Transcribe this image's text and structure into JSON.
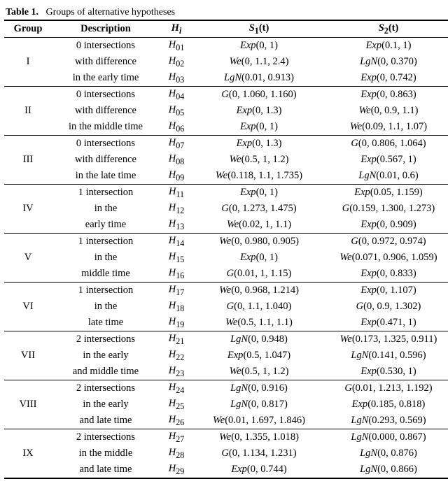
{
  "caption": {
    "label": "Table 1.",
    "text": "Groups of alternative hypotheses"
  },
  "headers": {
    "group": "Group",
    "description": "Description",
    "hi": "H",
    "hi_sub": "i",
    "s1": "S",
    "s1_sub": "1",
    "s1_arg": "(t)",
    "s2": "S",
    "s2_sub": "2",
    "s2_arg": "(t)"
  },
  "groups": [
    {
      "label": "I",
      "desc": [
        "0 intersections",
        "with difference",
        "in the early time"
      ],
      "rows": [
        {
          "h_pre": "H",
          "h_sub": "01",
          "s1": "Exp(0, 1)",
          "s2": "Exp(0.1, 1)"
        },
        {
          "h_pre": "H",
          "h_sub": "02",
          "s1": "We(0, 1.1, 2.4)",
          "s2": "LgN(0, 0.370)"
        },
        {
          "h_pre": "H",
          "h_sub": "03",
          "s1": "LgN(0.01, 0.913)",
          "s2": "Exp(0, 0.742)"
        }
      ]
    },
    {
      "label": "II",
      "desc": [
        "0 intersections",
        "with difference",
        "in the middle time"
      ],
      "rows": [
        {
          "h_pre": "H",
          "h_sub": "04",
          "s1": "G(0, 1.060, 1.160)",
          "s2": "Exp(0, 0.863)"
        },
        {
          "h_pre": "H",
          "h_sub": "05",
          "s1": "Exp(0, 1.3)",
          "s2": "We(0, 0.9, 1.1)"
        },
        {
          "h_pre": "H",
          "h_sub": "06",
          "s1": "Exp(0, 1)",
          "s2": "We(0.09, 1.1, 1.07)"
        }
      ]
    },
    {
      "label": "III",
      "desc": [
        "0 intersections",
        "with difference",
        "in the late time"
      ],
      "rows": [
        {
          "h_pre": "H",
          "h_sub": "07",
          "s1": "Exp(0, 1.3)",
          "s2": "G(0, 0.806, 1.064)"
        },
        {
          "h_pre": "H",
          "h_sub": "08",
          "s1": "We(0.5, 1, 1.2)",
          "s2": "Exp(0.567, 1)"
        },
        {
          "h_pre": "H",
          "h_sub": "09",
          "s1": "We(0.118, 1.1, 1.735)",
          "s2": "LgN(0.01, 0.6)"
        }
      ]
    },
    {
      "label": "IV",
      "desc": [
        "1 intersection",
        "in the",
        "early time"
      ],
      "rows": [
        {
          "h_pre": "H",
          "h_sub": "11",
          "s1": "Exp(0, 1)",
          "s2": "Exp(0.05, 1.159)"
        },
        {
          "h_pre": "H",
          "h_sub": "12",
          "s1": "G(0, 1.273, 1.475)",
          "s2": "G(0.159, 1.300, 1.273)"
        },
        {
          "h_pre": "H",
          "h_sub": "13",
          "s1": "We(0.02, 1, 1.1)",
          "s2": "Exp(0, 0.909)"
        }
      ]
    },
    {
      "label": "V",
      "desc": [
        "1 intersection",
        "in the",
        "middle time"
      ],
      "rows": [
        {
          "h_pre": "H",
          "h_sub": "14",
          "s1": "We(0, 0.980, 0.905)",
          "s2": "G(0, 0.972, 0.974)"
        },
        {
          "h_pre": "H",
          "h_sub": "15",
          "s1": "Exp(0, 1)",
          "s2": "We(0.071, 0.906, 1.059)"
        },
        {
          "h_pre": "H",
          "h_sub": "16",
          "s1": "G(0.01, 1, 1.15)",
          "s2": "Exp(0, 0.833)"
        }
      ]
    },
    {
      "label": "VI",
      "desc": [
        "1 intersection",
        "in the",
        "late time"
      ],
      "rows": [
        {
          "h_pre": "H",
          "h_sub": "17",
          "s1": "We(0, 0.968, 1.214)",
          "s2": "Exp(0, 1.107)"
        },
        {
          "h_pre": "H",
          "h_sub": "18",
          "s1": "G(0, 1.1, 1.040)",
          "s2": "G(0, 0.9, 1.302)"
        },
        {
          "h_pre": "H",
          "h_sub": "19",
          "s1": "We(0.5, 1.1, 1.1)",
          "s2": "Exp(0.471, 1)"
        }
      ]
    },
    {
      "label": "VII",
      "desc": [
        "2 intersections",
        "in the early",
        "and middle time"
      ],
      "rows": [
        {
          "h_pre": "H",
          "h_sub": "21",
          "s1": "LgN(0, 0.948)",
          "s2": "We(0.173, 1.325, 0.911)"
        },
        {
          "h_pre": "H",
          "h_sub": "22",
          "s1": "Exp(0.5, 1.047)",
          "s2": "LgN(0.141, 0.596)"
        },
        {
          "h_pre": "H",
          "h_sub": "23",
          "s1": "We(0.5, 1, 1.2)",
          "s2": "Exp(0.530, 1)"
        }
      ]
    },
    {
      "label": "VIII",
      "desc": [
        "2 intersections",
        "in the early",
        "and late time"
      ],
      "rows": [
        {
          "h_pre": "H",
          "h_sub": "24",
          "s1": "LgN(0, 0.916)",
          "s2": "G(0.01, 1.213, 1.192)"
        },
        {
          "h_pre": "H",
          "h_sub": "25",
          "s1": "LgN(0, 0.817)",
          "s2": "Exp(0.185, 0.818)"
        },
        {
          "h_pre": "H",
          "h_sub": "26",
          "s1": "We(0.01, 1.697, 1.846)",
          "s2": "LgN(0.293, 0.569)"
        }
      ]
    },
    {
      "label": "IX",
      "desc": [
        "2 intersections",
        "in the middle",
        "and late time"
      ],
      "rows": [
        {
          "h_pre": "H",
          "h_sub": "27",
          "s1": "We(0, 1.355, 1.018)",
          "s2": "LgN(0.000, 0.867)"
        },
        {
          "h_pre": "H",
          "h_sub": "28",
          "s1": "G(0, 1.134, 1.231)",
          "s2": "LgN(0, 0.876)"
        },
        {
          "h_pre": "H",
          "h_sub": "29",
          "s1": "Exp(0, 0.744)",
          "s2": "LgN(0, 0.866)"
        }
      ]
    }
  ]
}
